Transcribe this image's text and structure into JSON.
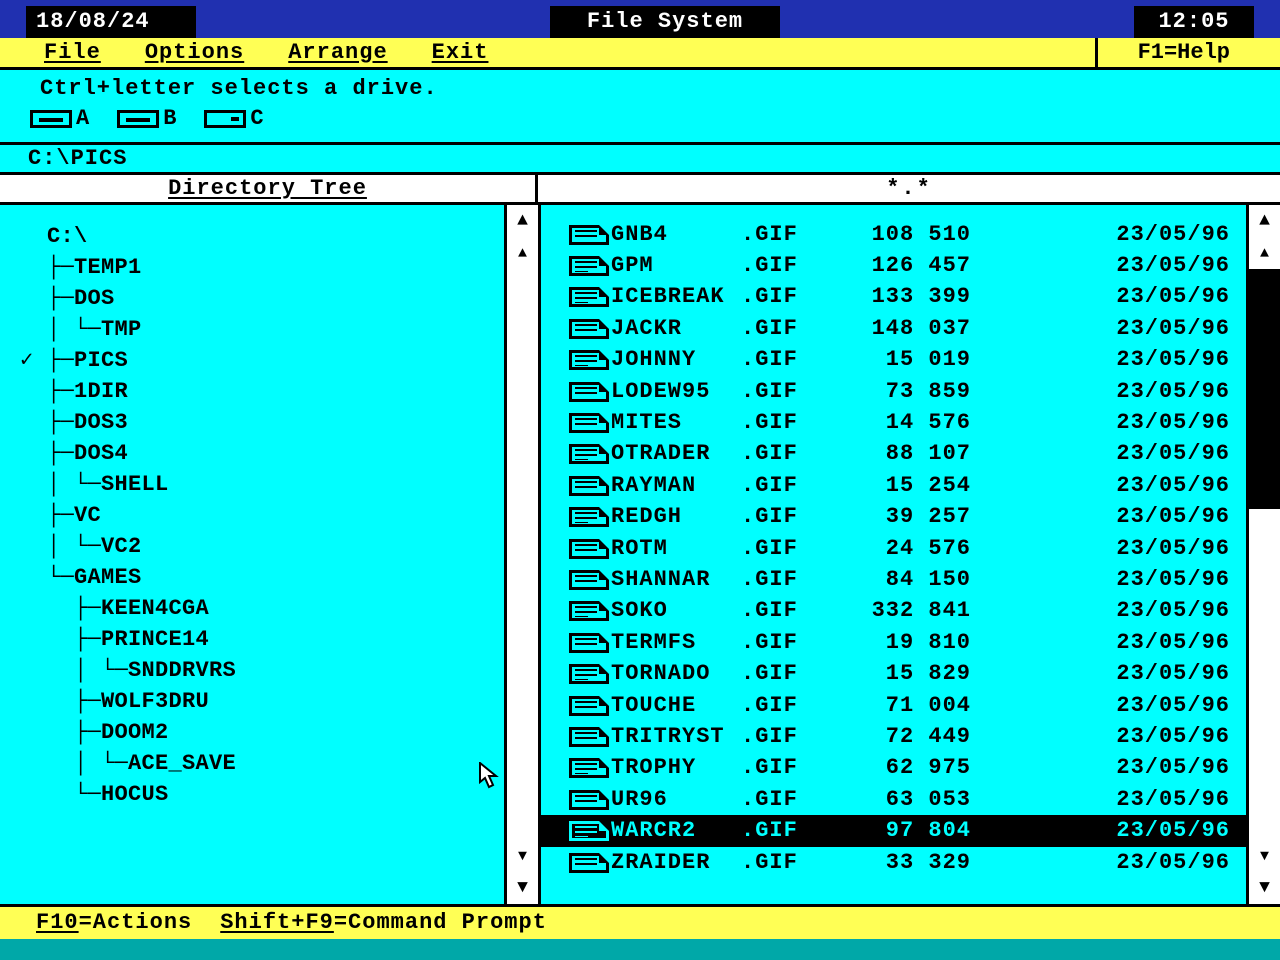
{
  "titlebar": {
    "date": "18/08/24",
    "title": "File System",
    "time": "12:05"
  },
  "menu": {
    "file": "File",
    "options": "Options",
    "arrange": "Arrange",
    "exit": "Exit",
    "help": "F1=Help"
  },
  "hint": "Ctrl+letter selects a drive.",
  "drives": {
    "a": "A",
    "b": "B",
    "c": "C"
  },
  "path": "C:\\PICS",
  "headers": {
    "left": "Directory Tree",
    "right": "*.*"
  },
  "tree": [
    {
      "indent": 0,
      "prefix": "",
      "label": "C:\\",
      "check": false
    },
    {
      "indent": 1,
      "prefix": "├─",
      "label": "TEMP1",
      "check": false
    },
    {
      "indent": 1,
      "prefix": "├─",
      "label": "DOS",
      "check": false
    },
    {
      "indent": 2,
      "prefix": "└─",
      "label": "TMP",
      "check": false,
      "cont": [
        1
      ]
    },
    {
      "indent": 1,
      "prefix": "├─",
      "label": "PICS",
      "check": true
    },
    {
      "indent": 1,
      "prefix": "├─",
      "label": "1DIR",
      "check": false
    },
    {
      "indent": 1,
      "prefix": "├─",
      "label": "DOS3",
      "check": false
    },
    {
      "indent": 1,
      "prefix": "├─",
      "label": "DOS4",
      "check": false
    },
    {
      "indent": 2,
      "prefix": "└─",
      "label": "SHELL",
      "check": false,
      "cont": [
        1
      ]
    },
    {
      "indent": 1,
      "prefix": "├─",
      "label": "VC",
      "check": false
    },
    {
      "indent": 2,
      "prefix": "└─",
      "label": "VC2",
      "check": false,
      "cont": [
        1
      ]
    },
    {
      "indent": 1,
      "prefix": "└─",
      "label": "GAMES",
      "check": false
    },
    {
      "indent": 2,
      "prefix": "├─",
      "label": "KEEN4CGA",
      "check": false,
      "cont": []
    },
    {
      "indent": 2,
      "prefix": "├─",
      "label": "PRINCE14",
      "check": false,
      "cont": []
    },
    {
      "indent": 3,
      "prefix": "└─",
      "label": "SNDDRVRS",
      "check": false,
      "cont": [
        2
      ]
    },
    {
      "indent": 2,
      "prefix": "├─",
      "label": "WOLF3DRU",
      "check": false,
      "cont": []
    },
    {
      "indent": 2,
      "prefix": "├─",
      "label": "DOOM2",
      "check": false,
      "cont": []
    },
    {
      "indent": 3,
      "prefix": "└─",
      "label": "ACE_SAVE",
      "check": false,
      "cont": [
        2
      ]
    },
    {
      "indent": 2,
      "prefix": "└─",
      "label": "HOCUS",
      "check": false,
      "cont": []
    }
  ],
  "files": [
    {
      "name": "GNB4",
      "ext": ".GIF",
      "size": "108 510",
      "date": "23/05/96",
      "sel": false
    },
    {
      "name": "GPM",
      "ext": ".GIF",
      "size": "126 457",
      "date": "23/05/96",
      "sel": false
    },
    {
      "name": "ICEBREAK",
      "ext": ".GIF",
      "size": "133 399",
      "date": "23/05/96",
      "sel": false
    },
    {
      "name": "JACKR",
      "ext": ".GIF",
      "size": "148 037",
      "date": "23/05/96",
      "sel": false
    },
    {
      "name": "JOHNNY",
      "ext": ".GIF",
      "size": "15 019",
      "date": "23/05/96",
      "sel": false
    },
    {
      "name": "LODEW95",
      "ext": ".GIF",
      "size": "73 859",
      "date": "23/05/96",
      "sel": false
    },
    {
      "name": "MITES",
      "ext": ".GIF",
      "size": "14 576",
      "date": "23/05/96",
      "sel": false
    },
    {
      "name": "OTRADER",
      "ext": ".GIF",
      "size": "88 107",
      "date": "23/05/96",
      "sel": false
    },
    {
      "name": "RAYMAN",
      "ext": ".GIF",
      "size": "15 254",
      "date": "23/05/96",
      "sel": false
    },
    {
      "name": "REDGH",
      "ext": ".GIF",
      "size": "39 257",
      "date": "23/05/96",
      "sel": false
    },
    {
      "name": "ROTM",
      "ext": ".GIF",
      "size": "24 576",
      "date": "23/05/96",
      "sel": false
    },
    {
      "name": "SHANNAR",
      "ext": ".GIF",
      "size": "84 150",
      "date": "23/05/96",
      "sel": false
    },
    {
      "name": "SOKO",
      "ext": ".GIF",
      "size": "332 841",
      "date": "23/05/96",
      "sel": false
    },
    {
      "name": "TERMFS",
      "ext": ".GIF",
      "size": "19 810",
      "date": "23/05/96",
      "sel": false
    },
    {
      "name": "TORNADO",
      "ext": ".GIF",
      "size": "15 829",
      "date": "23/05/96",
      "sel": false
    },
    {
      "name": "TOUCHE",
      "ext": ".GIF",
      "size": "71 004",
      "date": "23/05/96",
      "sel": false
    },
    {
      "name": "TRITRYST",
      "ext": ".GIF",
      "size": "72 449",
      "date": "23/05/96",
      "sel": false
    },
    {
      "name": "TROPHY",
      "ext": ".GIF",
      "size": "62 975",
      "date": "23/05/96",
      "sel": false
    },
    {
      "name": "UR96",
      "ext": ".GIF",
      "size": "63 053",
      "date": "23/05/96",
      "sel": false
    },
    {
      "name": "WARCR2",
      "ext": ".GIF",
      "size": "97 804",
      "date": "23/05/96",
      "sel": true
    },
    {
      "name": "ZRAIDER",
      "ext": ".GIF",
      "size": "33 329",
      "date": "23/05/96",
      "sel": false
    }
  ],
  "bottom": {
    "actions": "F10=Actions",
    "prompt": "Shift+F9=Command Prompt"
  }
}
